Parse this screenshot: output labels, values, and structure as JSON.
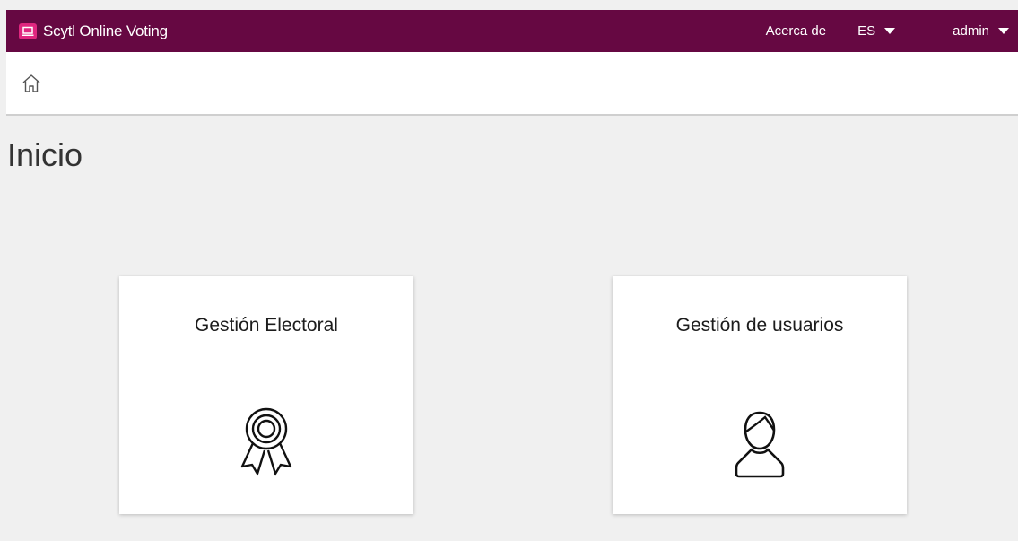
{
  "header": {
    "brand": "Scytl Online Voting",
    "about": "Acerca de",
    "language": "ES",
    "user": "admin",
    "brand_color": "#660842",
    "brand_icon_color": "#e0267f"
  },
  "breadcrumb": {
    "icon": "home-icon"
  },
  "page": {
    "title": "Inicio"
  },
  "cards": [
    {
      "title": "Gestión Electoral",
      "icon": "award-ribbon-icon"
    },
    {
      "title": "Gestión de usuarios",
      "icon": "user-icon"
    }
  ]
}
